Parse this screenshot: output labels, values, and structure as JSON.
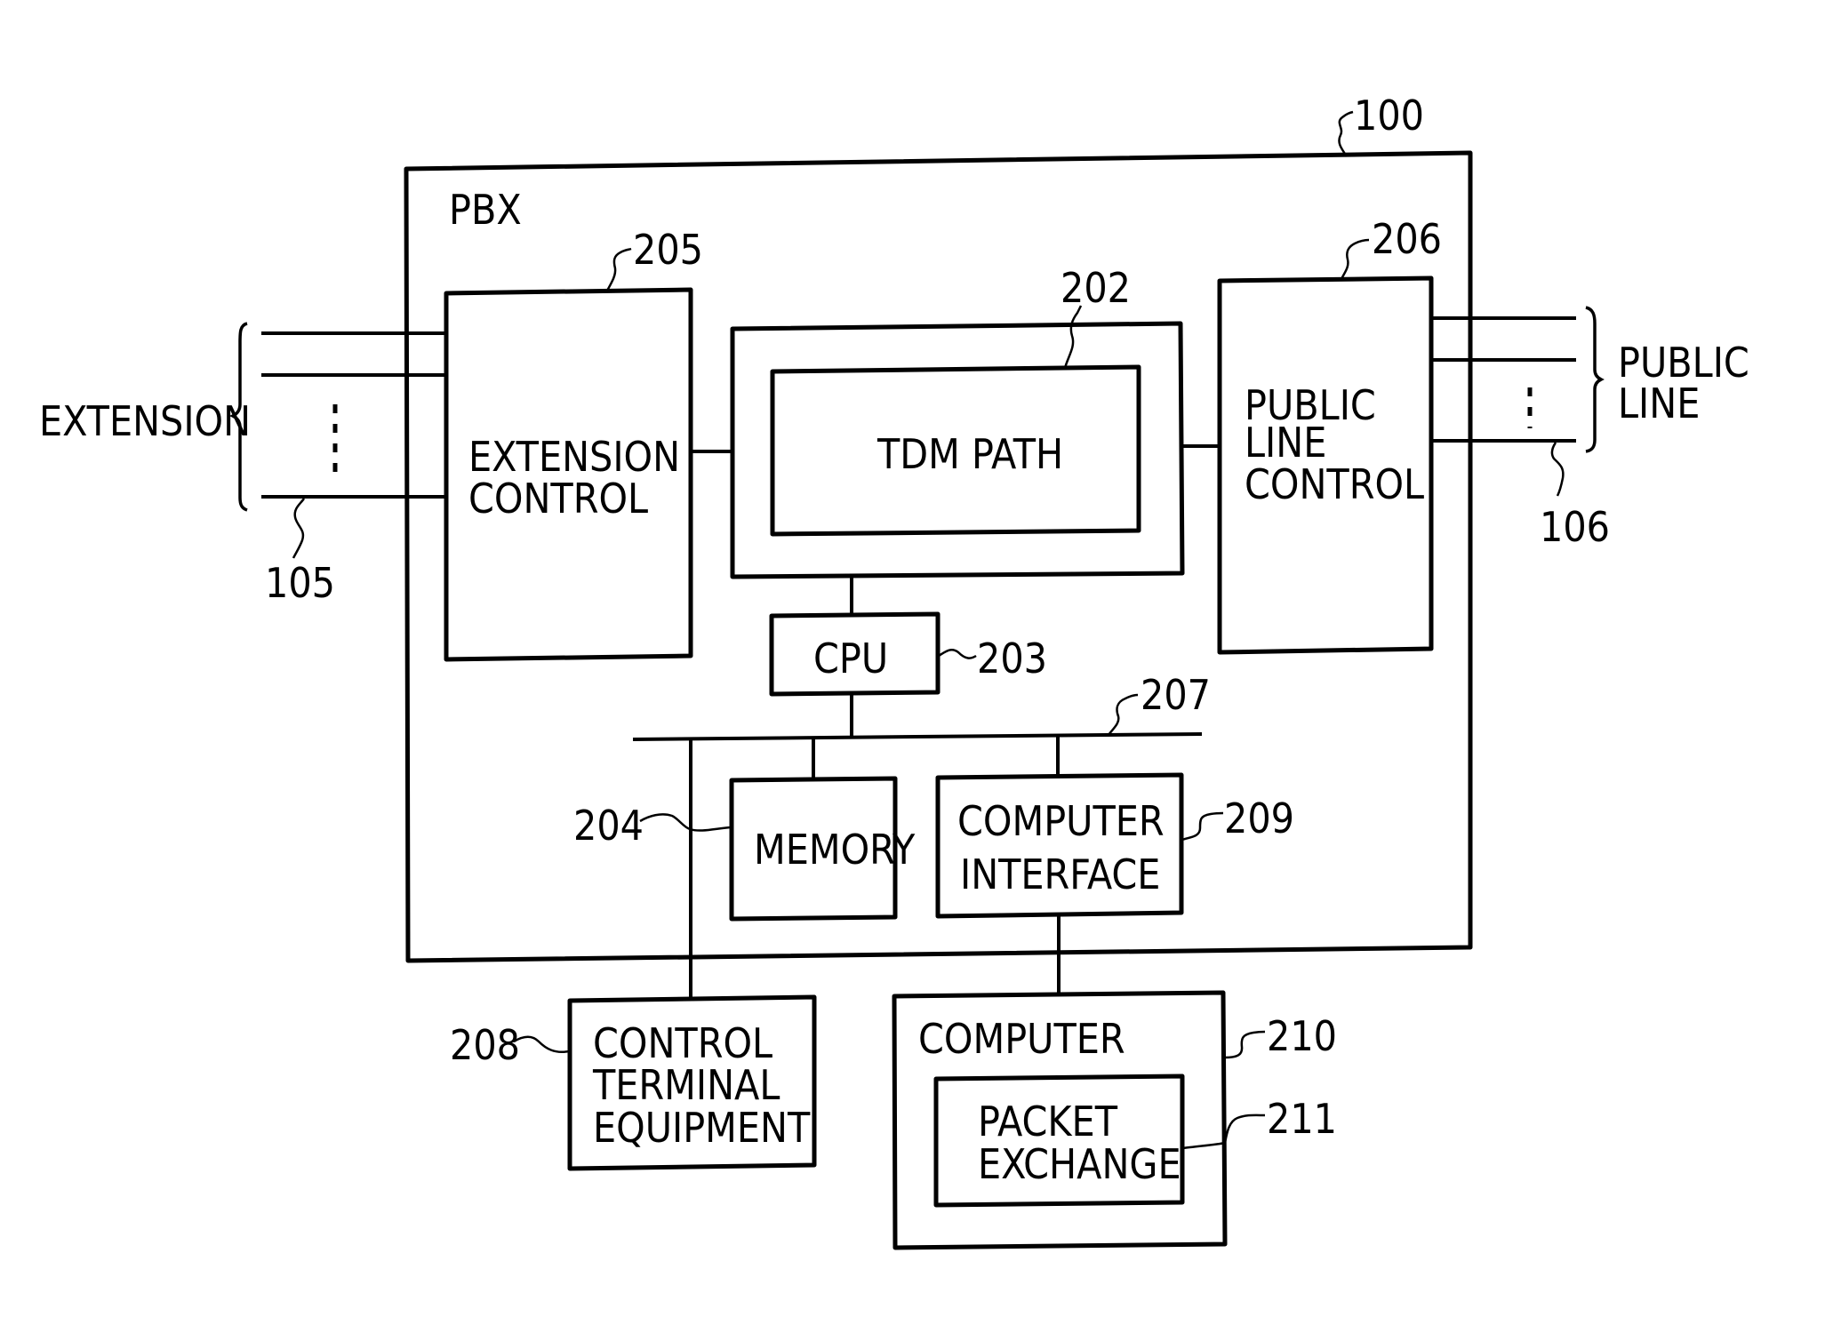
{
  "figure": {
    "pbx": {
      "label": "PBX",
      "ref": "100"
    },
    "extension": {
      "label": "EXTENSION",
      "ref": "105"
    },
    "public_line": {
      "label_lines": [
        "PUBLIC",
        "LINE"
      ],
      "ref": "106"
    },
    "blocks": {
      "extension_control": {
        "label_lines": [
          "EXTENSION",
          "CONTROL"
        ],
        "ref": "205"
      },
      "tdm_path": {
        "label": "TDM PATH",
        "ref": "202"
      },
      "public_line_control": {
        "label_lines": [
          "PUBLIC",
          "LINE",
          "CONTROL"
        ],
        "ref": "206"
      },
      "cpu": {
        "label": "CPU",
        "ref": "203"
      },
      "bus": {
        "ref": "207"
      },
      "memory": {
        "label": "MEMORY",
        "ref": "204"
      },
      "computer_interface": {
        "label_lines": [
          "COMPUTER",
          "INTERFACE"
        ],
        "ref": "209"
      },
      "control_terminal_equipment": {
        "label_lines": [
          "CONTROL",
          "TERMINAL",
          "EQUIPMENT"
        ],
        "ref": "208"
      },
      "computer": {
        "label": "COMPUTER",
        "ref": "210"
      },
      "packet_exchange": {
        "label_lines": [
          "PACKET",
          "EXCHANGE"
        ],
        "ref": "211"
      }
    }
  }
}
